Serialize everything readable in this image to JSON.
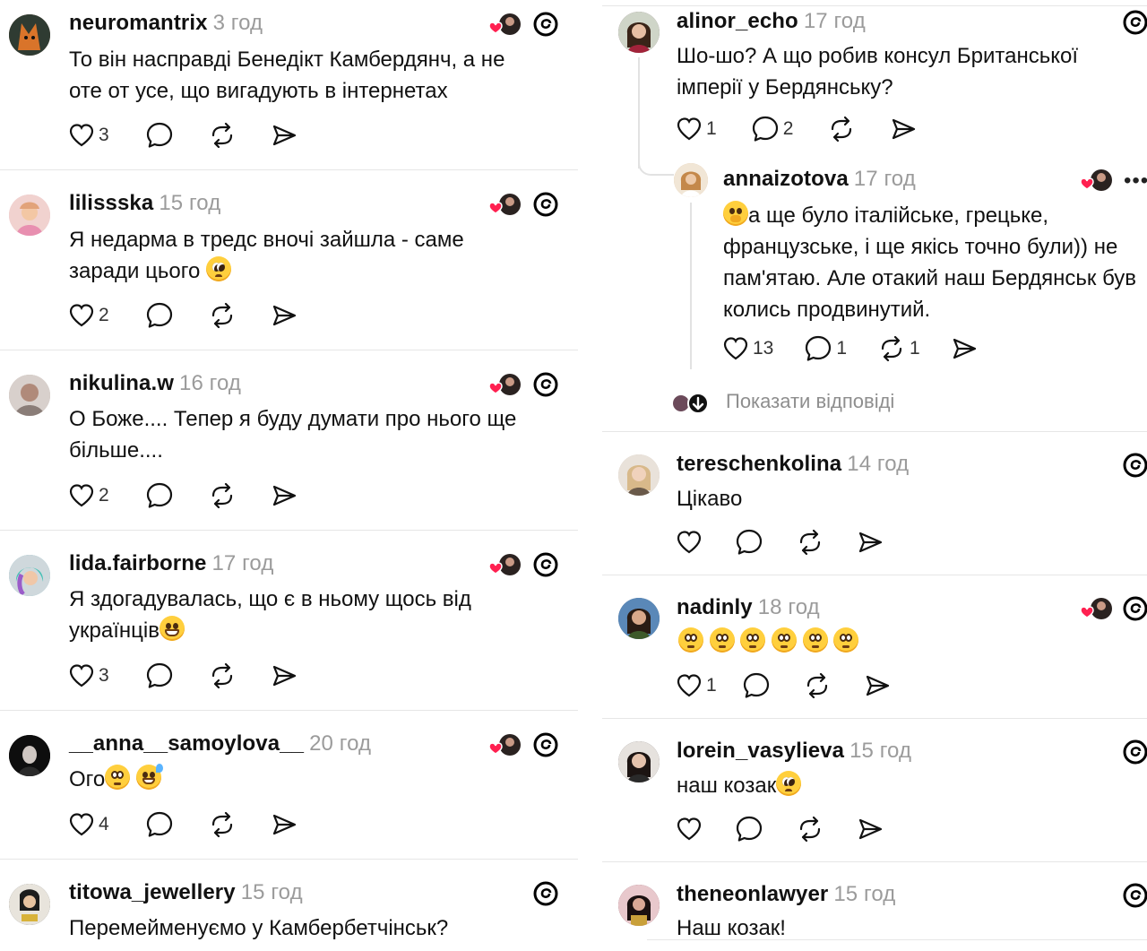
{
  "left_column": {
    "posts": [
      {
        "username": "neuromantrix",
        "time": "3 год",
        "lines": [
          "То він насправді Бенедікт Камбердянч, а не",
          "оте от усе, що вигадують в інтернетах"
        ],
        "likes": "3",
        "liked_by_author": true,
        "avatar_color": "#7a4a2a"
      },
      {
        "username": "lilissska",
        "time": "15 год",
        "lines": [
          "Я недарма в тредс вночі зайшла - саме",
          "заради цього"
        ],
        "emoji_line2": [
          "pleading-face"
        ],
        "likes": "2",
        "liked_by_author": true,
        "avatar_color": "#e7b9c8"
      },
      {
        "username": "nikulina.w",
        "time": "16 год",
        "lines": [
          "О Боже.... Тепер я буду думати про нього ще",
          "більше...."
        ],
        "likes": "2",
        "liked_by_author": true,
        "avatar_color": "#b8a69a"
      },
      {
        "username": "lida.fairborne",
        "time": "17 год",
        "lines": [
          "Я здогадувалась, що є в ньому щось від",
          "українців"
        ],
        "emoji_line2": [
          "grinning-face"
        ],
        "likes": "3",
        "liked_by_author": true,
        "avatar_color": "#5fa9b8"
      },
      {
        "username": "__anna__samoylova__",
        "time": "20 год",
        "lines": [
          "Ого"
        ],
        "emoji_line1": [
          "flushed-face",
          "sweat-smile-face"
        ],
        "likes": "4",
        "liked_by_author": true,
        "avatar_color": "#1a1a1a"
      },
      {
        "username": "titowa_jewellery",
        "time": "15 год",
        "lines": [
          "Перемейменуємо у Камбербетчінськ?"
        ],
        "likes": "",
        "liked_by_author": false,
        "avatar_color": "#3b3b3b"
      }
    ]
  },
  "right_column": {
    "posts": [
      {
        "username": "alinor_echo",
        "time": "17 год",
        "lines": [
          "Шо-шо? А що робив консул Британської",
          "імперії у Бердянську?"
        ],
        "likes": "1",
        "replies": "2",
        "avatar_color": "#6b4a5a"
      },
      {
        "username": "annaizotova",
        "time": "17 год",
        "lines": [
          "а ще було італійське,  грецьке,",
          "французське,  і ще якісь точно були)) не",
          "пам'ятаю. Але отакий наш Бердянськ був",
          "колись продвинутий."
        ],
        "emoji_line1": [
          "hushed-face"
        ],
        "likes": "13",
        "replies": "1",
        "reposts": "1",
        "liked_by_author": true,
        "more_label": "•••",
        "avatar_color": "#d9b48a"
      },
      {
        "show_replies": "Показати відповіді"
      },
      {
        "username": "tereschenkolina",
        "time": "14 год",
        "lines": [
          "Цікаво"
        ],
        "likes": "",
        "avatar_color": "#c9b7a8"
      },
      {
        "username": "nadinly",
        "time": "18 год",
        "lines": [
          ""
        ],
        "emoji_line1": [
          "flushed-face",
          "flushed-face",
          "flushed-face",
          "flushed-face",
          "flushed-face",
          "flushed-face"
        ],
        "likes": "1",
        "liked_by_author": true,
        "avatar_color": "#4a6a8a"
      },
      {
        "username": "lorein_vasylieva",
        "time": "15 год",
        "lines": [
          "наш козак"
        ],
        "emoji_line1_after": [
          "pleading-face"
        ],
        "likes": "",
        "avatar_color": "#3a3030"
      },
      {
        "username": "theneonlawyer",
        "time": "15 год",
        "lines": [
          "Наш козак!"
        ],
        "likes": "",
        "avatar_color": "#6a2a3a"
      }
    ]
  }
}
